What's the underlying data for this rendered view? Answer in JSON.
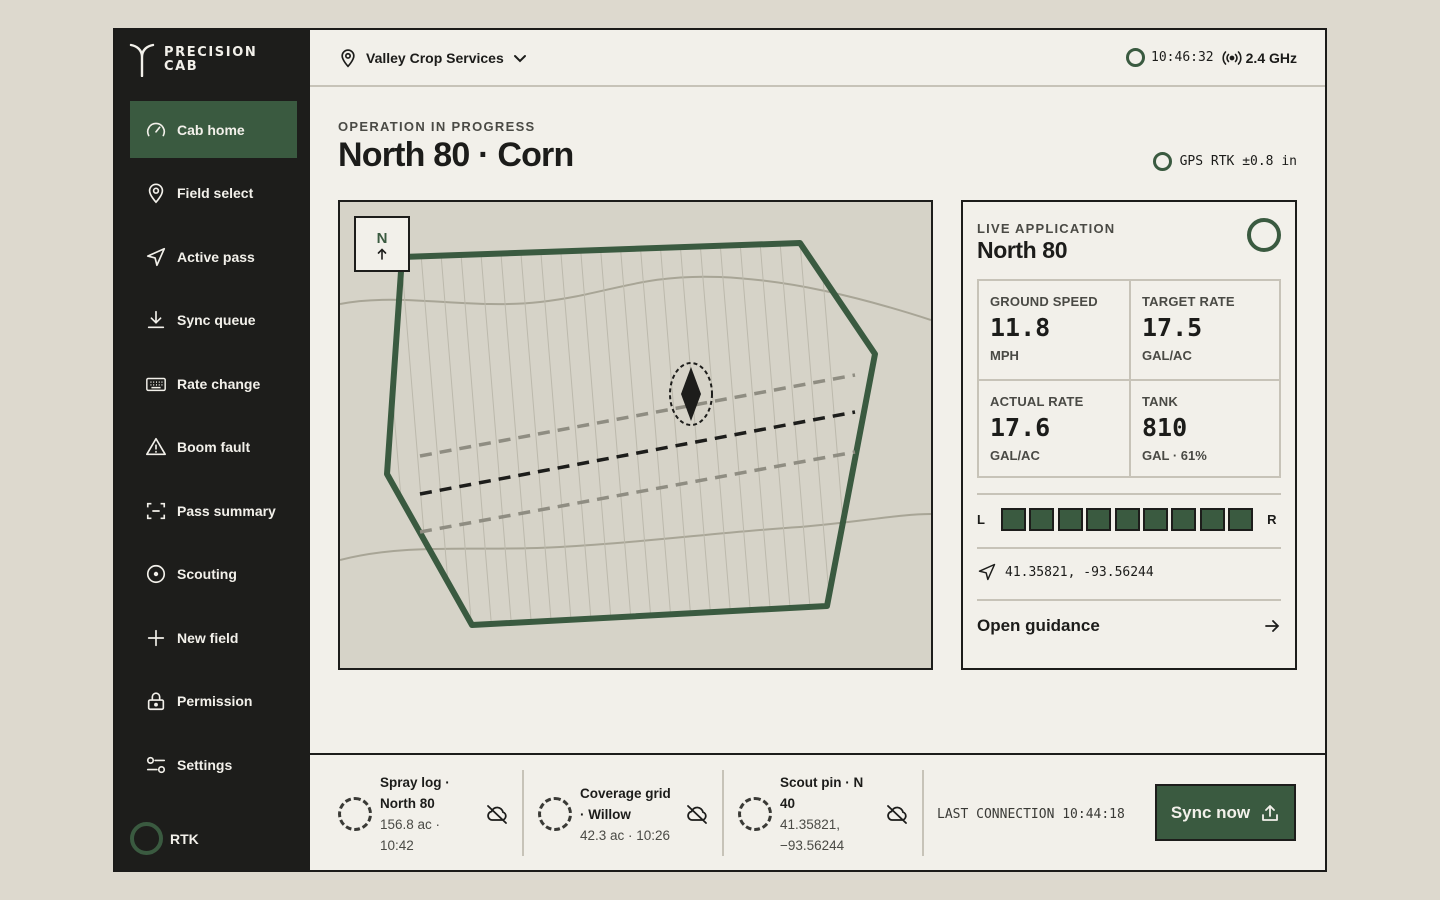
{
  "brand": {
    "line1": "PRECISION",
    "line2": "CAB"
  },
  "sidebar": {
    "items": [
      {
        "label": "Cab home",
        "icon": "gauge-icon",
        "active": true
      },
      {
        "label": "Field select",
        "icon": "map-pin-icon"
      },
      {
        "label": "Active pass",
        "icon": "navigation-arrow-icon"
      },
      {
        "label": "Sync queue",
        "icon": "download-icon"
      },
      {
        "label": "Rate change",
        "icon": "keyboard-icon"
      },
      {
        "label": "Boom fault",
        "icon": "warning-triangle-icon"
      },
      {
        "label": "Pass summary",
        "icon": "scan-frame-icon"
      },
      {
        "label": "Scouting",
        "icon": "target-icon"
      },
      {
        "label": "New field",
        "icon": "plus-icon"
      },
      {
        "label": "Permission",
        "icon": "lock-icon"
      },
      {
        "label": "Settings",
        "icon": "sliders-icon"
      }
    ],
    "rtk_label": "RTK"
  },
  "header": {
    "organization": "Valley Crop Services",
    "clock": "10:46:32",
    "radio": "2.4 GHz"
  },
  "main": {
    "eyebrow": "OPERATION IN PROGRESS",
    "title": "North 80 · Corn",
    "gps": "GPS RTK ±0.8 in",
    "compass": "N"
  },
  "panel": {
    "eyebrow": "LIVE APPLICATION",
    "title": "North 80",
    "metrics": [
      {
        "label": "GROUND SPEED",
        "value": "11.8",
        "unit": "MPH"
      },
      {
        "label": "TARGET RATE",
        "value": "17.5",
        "unit": "GAL/AC"
      },
      {
        "label": "ACTUAL RATE",
        "value": "17.6",
        "unit": "GAL/AC"
      },
      {
        "label": "TANK",
        "value": "810",
        "unit": "GAL · 61%"
      }
    ],
    "boom": {
      "left": "L",
      "right": "R",
      "sections_on": 9
    },
    "coords": "41.35821, -93.56244",
    "guidance": "Open guidance"
  },
  "queue": [
    {
      "title": "Spray log · North 80",
      "sub": "156.8 ac · 10:42"
    },
    {
      "title": "Coverage grid · Willow",
      "sub": "42.3 ac · 10:26"
    },
    {
      "title": "Scout pin · N 40",
      "sub": "41.35821, −93.56244"
    }
  ],
  "sync": {
    "last_connection": "LAST CONNECTION 10:44:18",
    "button": "Sync now"
  },
  "colors": {
    "accent": "#3a5a40",
    "dark": "#1d1d1b",
    "paper": "#f2f0ea",
    "map_bg": "#d6d3c8"
  }
}
